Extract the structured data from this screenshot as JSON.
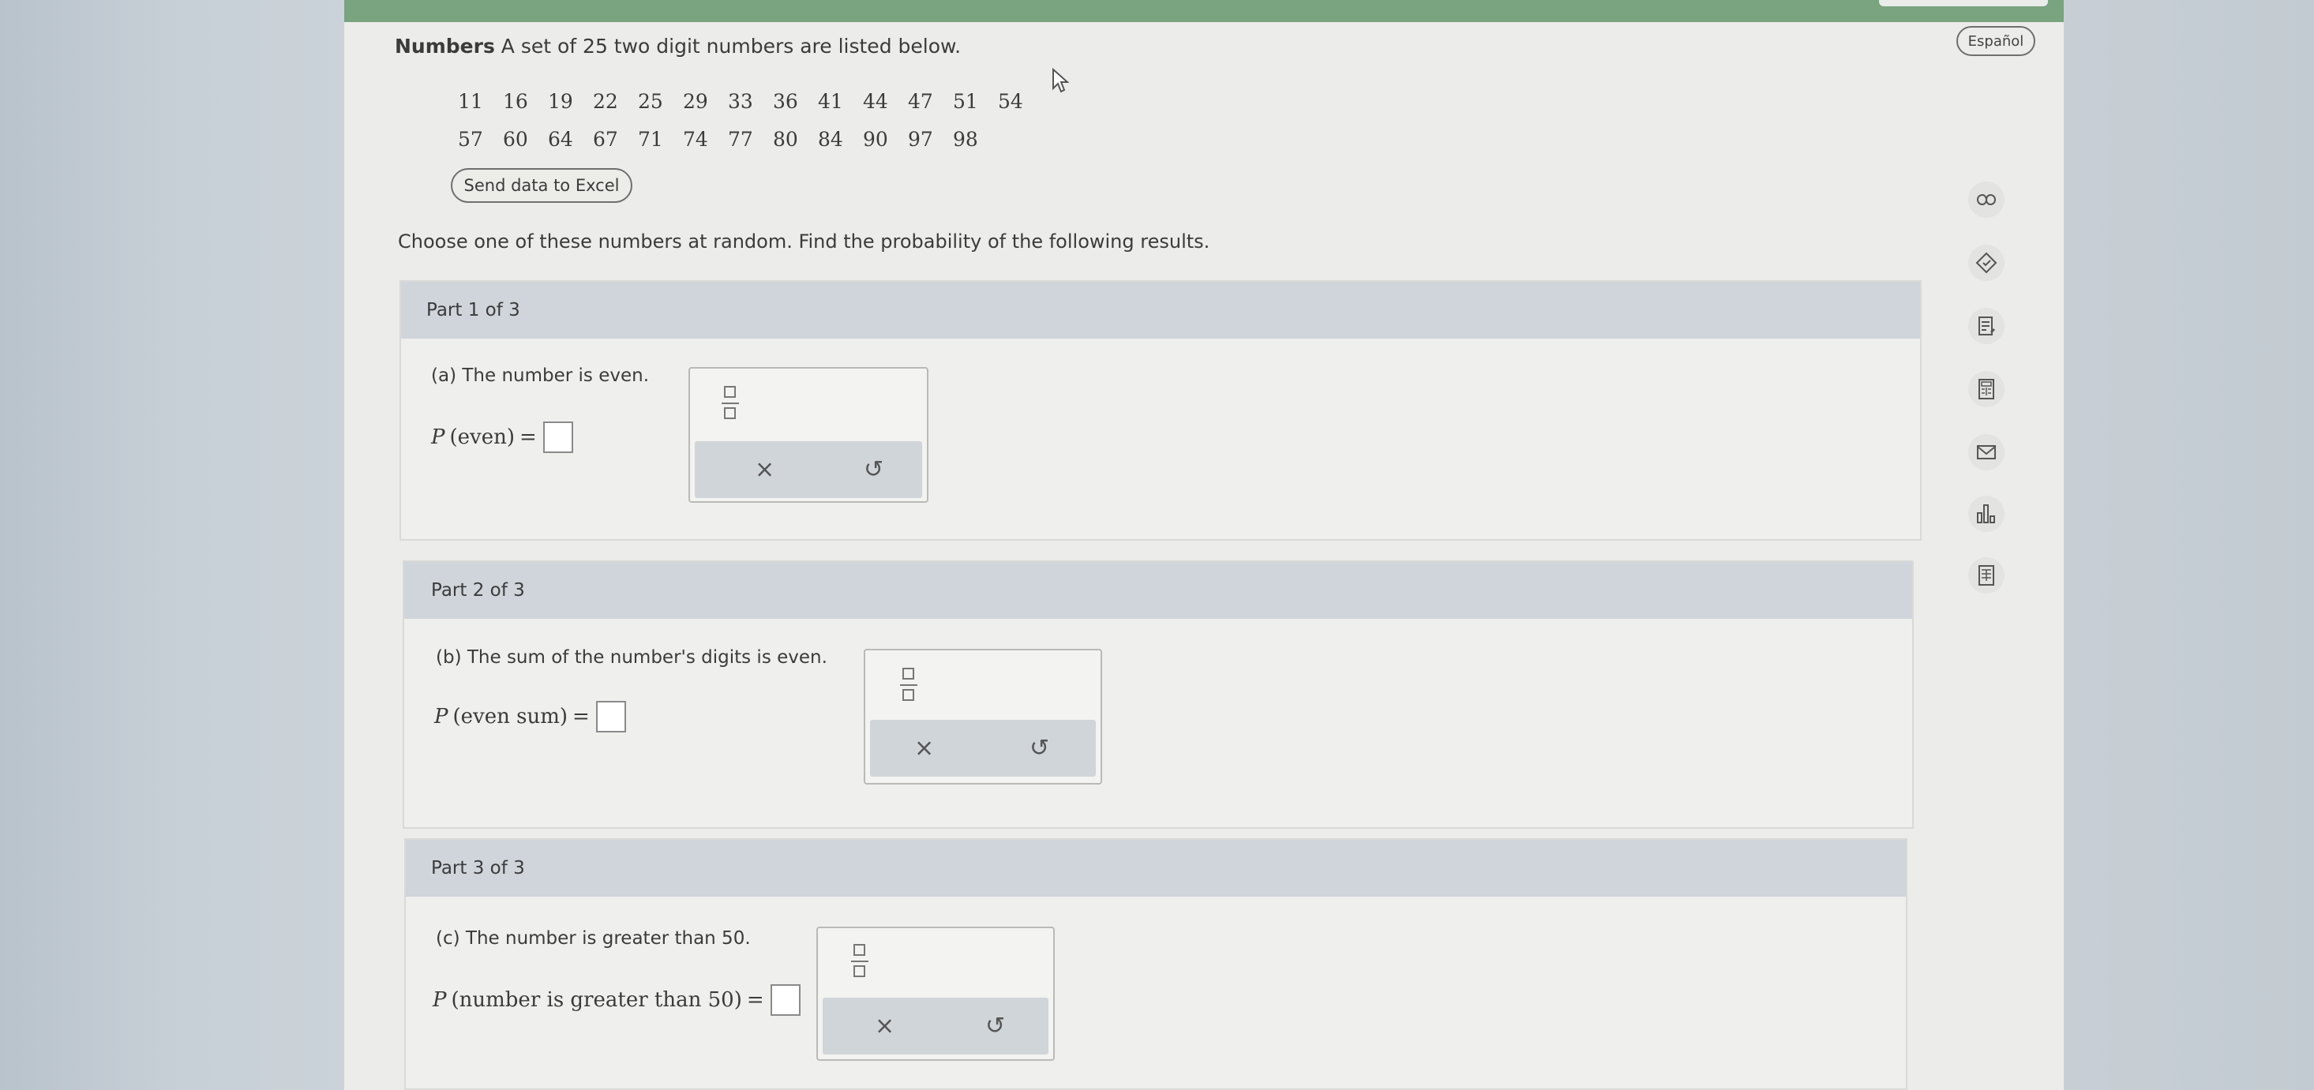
{
  "header": {
    "language_button": "Español"
  },
  "intro": {
    "bold_label": "Numbers",
    "text": "A set of 25 two digit numbers are listed below."
  },
  "numbers": {
    "row1": [
      "11",
      "16",
      "19",
      "22",
      "25",
      "29",
      "33",
      "36",
      "41",
      "44",
      "47",
      "51",
      "54"
    ],
    "row2": [
      "57",
      "60",
      "64",
      "67",
      "71",
      "74",
      "77",
      "80",
      "84",
      "90",
      "97",
      "98"
    ]
  },
  "send_button": "Send data to Excel",
  "instructions": "Choose one of these numbers at random. Find the probability of the following results.",
  "parts": [
    {
      "header": "Part 1 of 3",
      "question": "(a) The number is even.",
      "prob_label": "P",
      "prob_arg": "(even)",
      "equals": "="
    },
    {
      "header": "Part 2 of 3",
      "question": "(b) The sum of the number's digits is even.",
      "prob_label": "P",
      "prob_arg": "(even sum)",
      "equals": "="
    },
    {
      "header": "Part 3 of 3",
      "question": "(c) The number is greater than 50.",
      "prob_label": "P",
      "prob_arg": "(number is greater than 50)",
      "equals": "="
    }
  ],
  "tools": {
    "clear": "×",
    "undo": "↺"
  },
  "side_icons": [
    "infinity-icon",
    "tag-icon",
    "notes-icon",
    "calculator-icon",
    "mail-icon",
    "chart-icon",
    "table-icon"
  ],
  "colors": {
    "top_bar": "#7aa380",
    "part_header": "#cfd5da",
    "page": "#ececea"
  }
}
